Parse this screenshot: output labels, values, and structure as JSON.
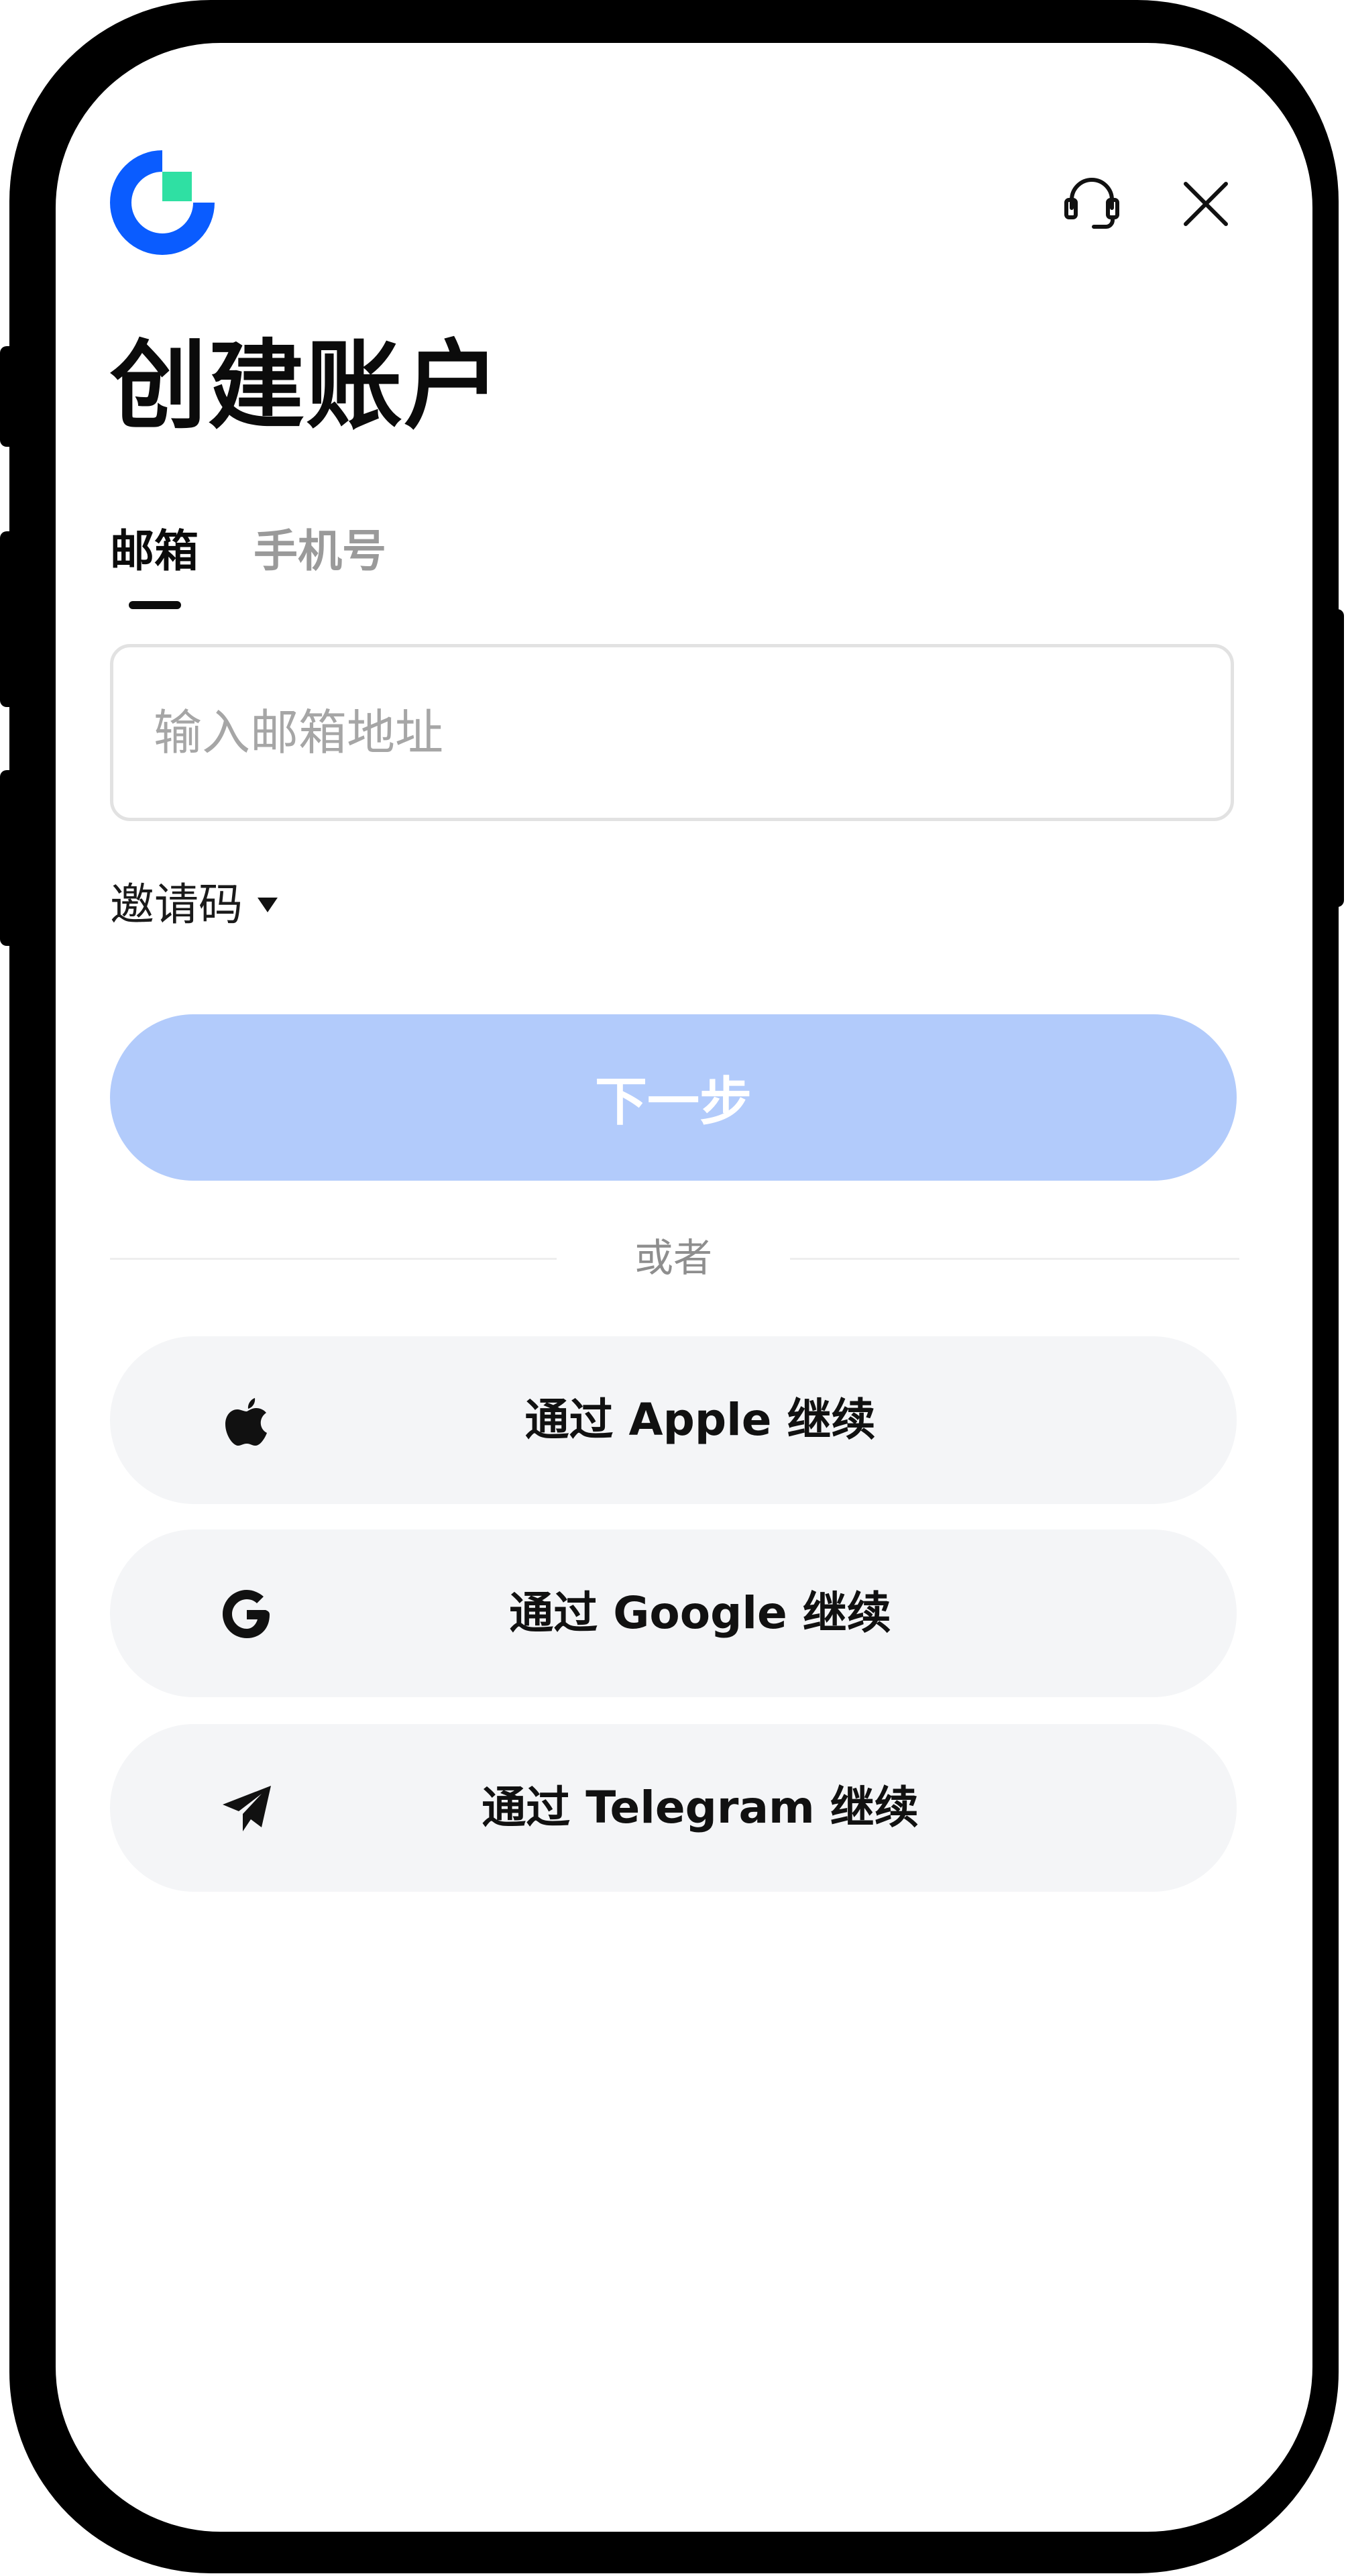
{
  "header": {
    "logo_icon": "brand-logo",
    "support_icon": "headset-icon",
    "close_icon": "close-icon",
    "brand_colors": {
      "blue": "#0a5cff",
      "green": "#2fe0a3"
    }
  },
  "title": "创建账户",
  "tabs": [
    {
      "label": "邮箱",
      "active": true
    },
    {
      "label": "手机号",
      "active": false
    }
  ],
  "email": {
    "placeholder": "输入邮箱地址",
    "value": ""
  },
  "invite": {
    "label": "邀请码",
    "caret_icon": "caret-down-icon"
  },
  "next_button": {
    "label": "下一步",
    "color": "#b2cbfb",
    "enabled": false
  },
  "divider": {
    "text": "或者"
  },
  "social": [
    {
      "label": "通过 Apple 继续",
      "icon": "apple-icon"
    },
    {
      "label": "通过 Google 继续",
      "icon": "google-icon"
    },
    {
      "label": "通过 Telegram 继续",
      "icon": "telegram-icon"
    }
  ]
}
